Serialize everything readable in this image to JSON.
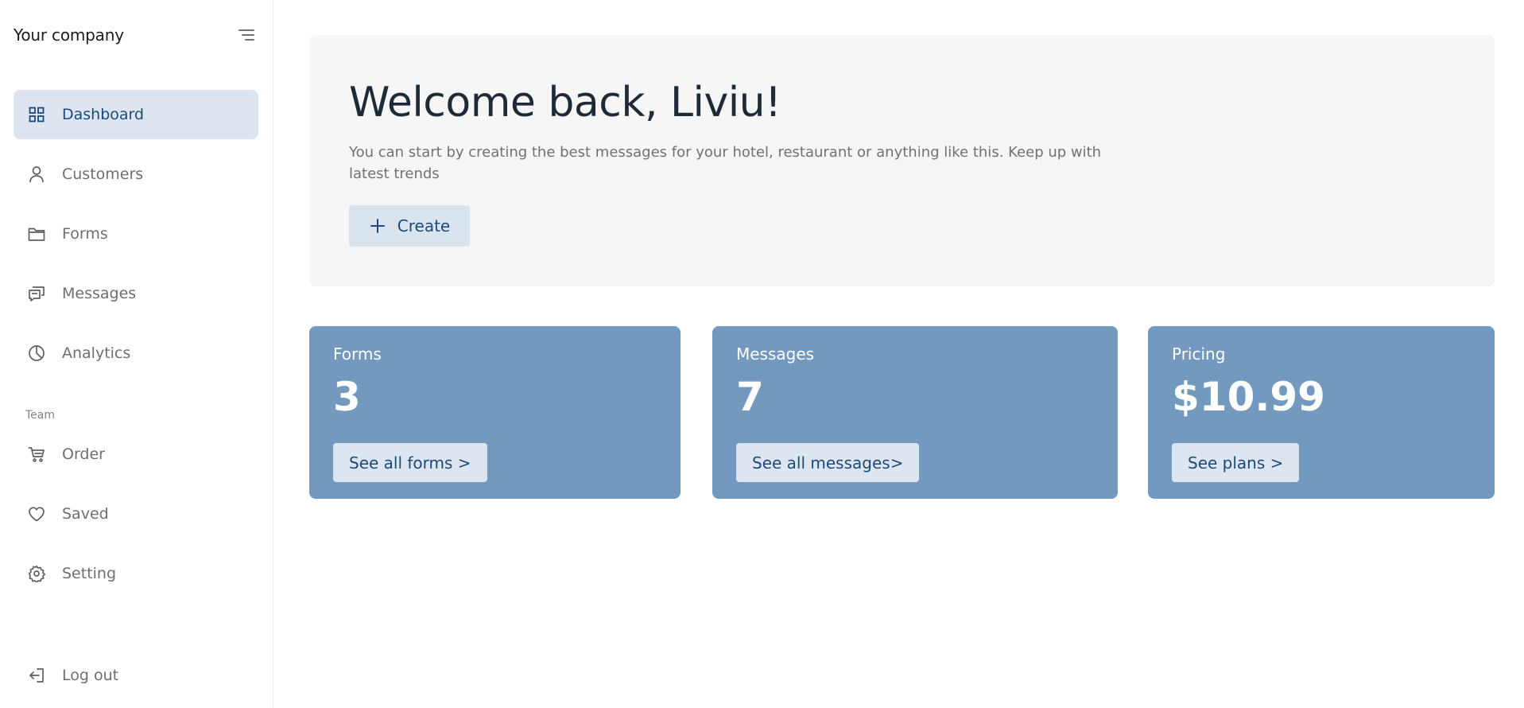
{
  "sidebar": {
    "brand": "Your company",
    "menu_toggle_icon": "menu-lines-icon",
    "items": [
      {
        "label": "Dashboard",
        "icon": "grid-icon",
        "active": true
      },
      {
        "label": "Customers",
        "icon": "user-icon",
        "active": false
      },
      {
        "label": "Forms",
        "icon": "folder-icon",
        "active": false
      },
      {
        "label": "Messages",
        "icon": "chat-icon",
        "active": false
      },
      {
        "label": "Analytics",
        "icon": "pie-chart-icon",
        "active": false
      }
    ],
    "section_label": "Team",
    "team_items": [
      {
        "label": "Order",
        "icon": "cart-icon"
      },
      {
        "label": "Saved",
        "icon": "heart-icon"
      },
      {
        "label": "Setting",
        "icon": "gear-icon"
      }
    ],
    "logout": {
      "label": "Log out",
      "icon": "logout-icon"
    }
  },
  "hero": {
    "title": "Welcome back, Liviu!",
    "description": "You can start by creating the best messages for your hotel, restaurant or anything like this. Keep up with latest trends",
    "create_label": "Create"
  },
  "cards": {
    "forms": {
      "title": "Forms",
      "value": "3",
      "button": "See all forms >"
    },
    "messages": {
      "title": "Messages",
      "value": "7",
      "button": "See all messages>"
    },
    "pricing": {
      "title": "Pricing",
      "value": "$10.99",
      "button": "See plans >"
    }
  },
  "colors": {
    "accent": "#1b4a7a",
    "active_bg": "#dde6f0",
    "card_bg": "#7399bf",
    "hero_bg": "#f6f6f6"
  }
}
